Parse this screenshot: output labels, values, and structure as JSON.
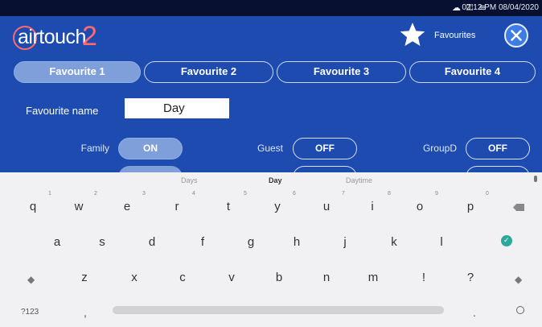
{
  "status_bar": {
    "icons": "☁ ⚿ ≋",
    "time": "02:12 PM 08/04/2020"
  },
  "header": {
    "logo_text": "airtouch",
    "logo_version": "2",
    "favourites_label": "Favourites",
    "close_symbol": "✕"
  },
  "tabs": [
    {
      "label": "Favourite 1",
      "active": true
    },
    {
      "label": "Favourite 2",
      "active": false
    },
    {
      "label": "Favourite 3",
      "active": false
    },
    {
      "label": "Favourite 4",
      "active": false
    }
  ],
  "favourite_name": {
    "label": "Favourite name",
    "value": "Day"
  },
  "groups": [
    {
      "label": "Family",
      "state": "ON"
    },
    {
      "label": "Guest",
      "state": "OFF"
    },
    {
      "label": "GroupD",
      "state": "OFF"
    }
  ],
  "keyboard": {
    "suggestions": [
      "Days",
      "Day",
      "Daytime"
    ],
    "row1": [
      "q",
      "w",
      "e",
      "r",
      "t",
      "y",
      "u",
      "i",
      "o",
      "p"
    ],
    "row1_hints": [
      "1",
      "2",
      "3",
      "4",
      "5",
      "6",
      "7",
      "8",
      "9",
      "0"
    ],
    "row2": [
      "a",
      "s",
      "d",
      "f",
      "g",
      "h",
      "j",
      "k",
      "l"
    ],
    "row3": [
      "z",
      "x",
      "c",
      "v",
      "b",
      "n",
      "m",
      "!",
      "?"
    ],
    "shift_symbol": "◆",
    "symbols_key": "?123",
    "comma": ",",
    "period": ".",
    "enter_symbol": "✓"
  },
  "colors": {
    "background": "#1d4bb0",
    "active_tab": "#7e9fd9",
    "logo_accent": "#ff6a6a",
    "enter_key": "#2aaa9a"
  }
}
